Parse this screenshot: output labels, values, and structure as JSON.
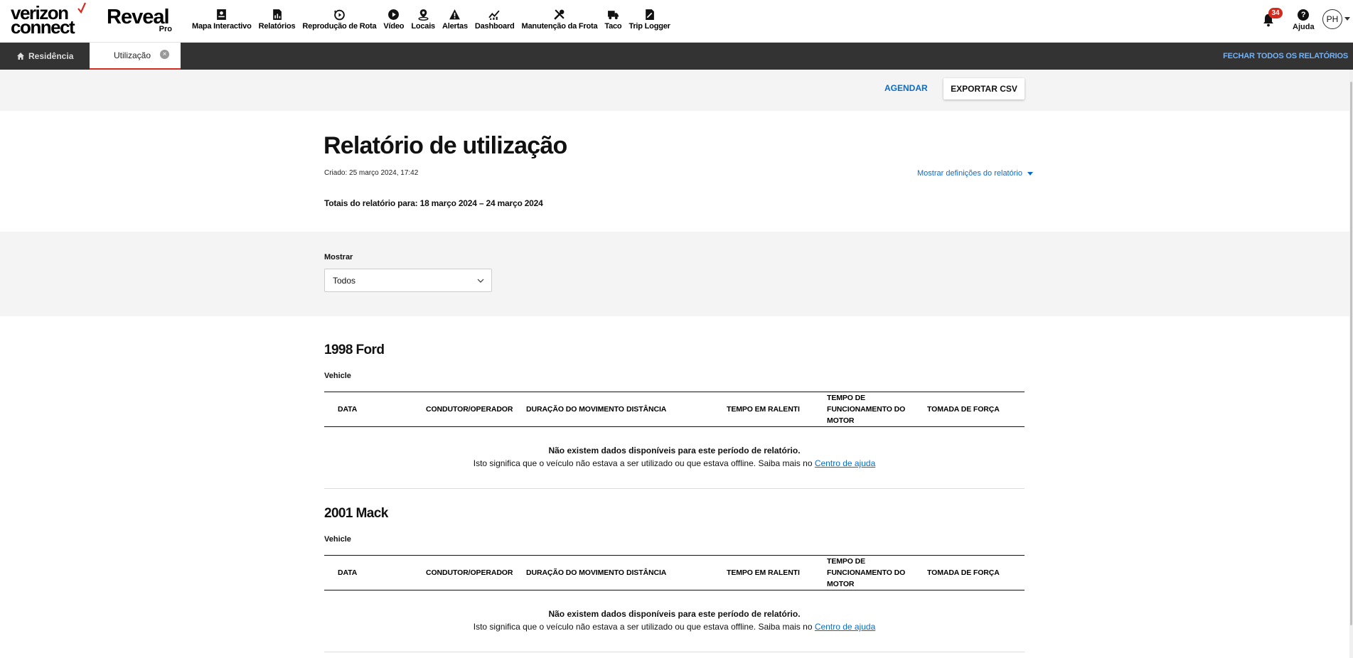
{
  "brand": {
    "logo_line1": "verizon",
    "logo_line2": "connect",
    "product": "Reveal",
    "tier": "Pro"
  },
  "nav": [
    {
      "label": "Mapa Interactivo",
      "icon": "map-icon"
    },
    {
      "label": "Relatórios",
      "icon": "report-icon"
    },
    {
      "label": "Reprodução de Rota",
      "icon": "replay-icon"
    },
    {
      "label": "Vídeo",
      "icon": "play-icon"
    },
    {
      "label": "Locais",
      "icon": "location-icon"
    },
    {
      "label": "Alertas",
      "icon": "alert-icon"
    },
    {
      "label": "Dashboard",
      "icon": "dashboard-icon"
    },
    {
      "label": "Manutenção da Frota",
      "icon": "wrench-icon"
    },
    {
      "label": "Taco",
      "icon": "truck-icon"
    },
    {
      "label": "Trip Logger",
      "icon": "trip-logger-icon"
    }
  ],
  "header_right": {
    "notifications_count": "34",
    "help_label": "Ajuda",
    "avatar_initials": "PH"
  },
  "tabs": {
    "home_label": "Residência",
    "active_label": "Utilização",
    "close_all_label": "FECHAR TODOS OS RELATÓRIOS"
  },
  "actions": {
    "schedule_label": "AGENDAR",
    "export_label": "EXPORTAR CSV"
  },
  "report": {
    "title": "Relatório de utilização",
    "created": "Criado: 25 março 2024, 17:42",
    "show_settings": "Mostrar definições do relatório",
    "totals": "Totais do relatório para: 18 março 2024 – 24 março 2024"
  },
  "filter": {
    "label": "Mostrar",
    "value": "Todos"
  },
  "columns": [
    "DATA",
    "CONDUTOR/OPERADOR",
    "DURAÇÃO DO MOVIMENTO",
    "DISTÂNCIA",
    "TEMPO EM RALENTI",
    "TEMPO DE FUNCIONAMENTO DO MOTOR",
    "TOMADA DE FORÇA"
  ],
  "vehicles": [
    {
      "name": "1998 Ford",
      "type": "Vehicle",
      "empty_title": "Não existem dados disponíveis para este período de relatório.",
      "empty_text": "Isto significa que o veículo não estava a ser utilizado ou que estava offline. Saiba mais no",
      "help_link": "Centro de ajuda"
    },
    {
      "name": "2001 Mack",
      "type": "Vehicle",
      "empty_title": "Não existem dados disponíveis para este período de relatório.",
      "empty_text": "Isto significa que o veículo não estava a ser utilizado ou que estava offline. Saiba mais no",
      "help_link": "Centro de ajuda"
    }
  ],
  "colors": {
    "accent_red": "#d52b1e",
    "link_blue": "#0a6cc9",
    "tabbar_bg": "#333333"
  }
}
